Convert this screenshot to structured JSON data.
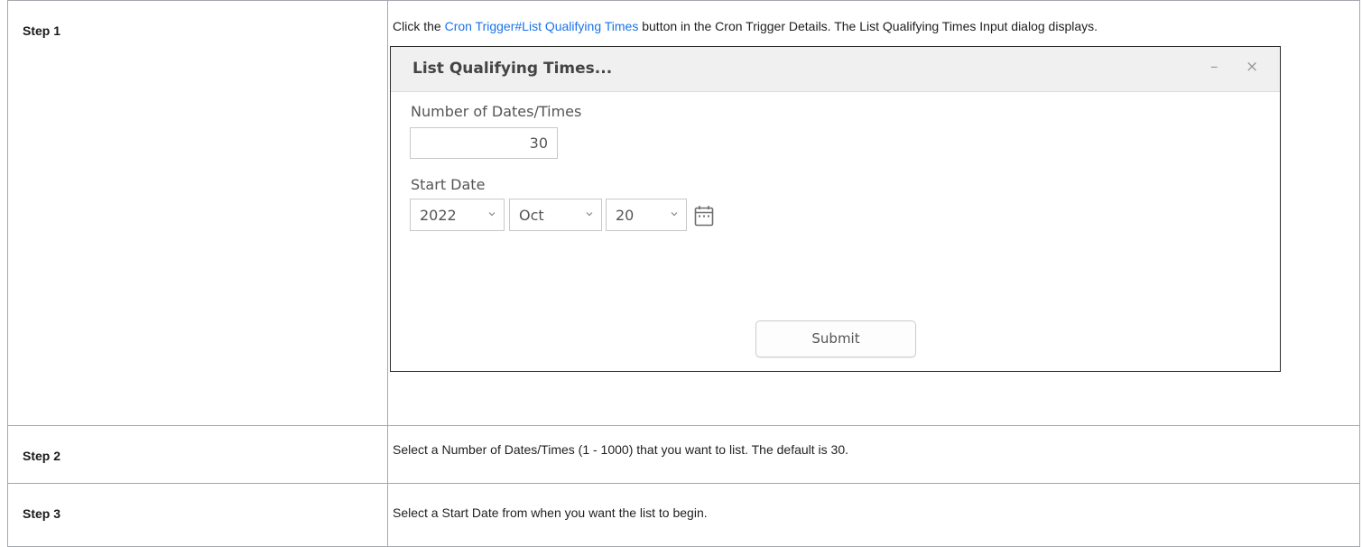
{
  "steps": [
    {
      "label": "Step 1",
      "text_before_link": "Click the ",
      "link_text": "Cron Trigger#List Qualifying Times",
      "text_after_link": " button in the Cron Trigger Details. The List Qualifying Times Input dialog displays."
    },
    {
      "label": "Step 2",
      "text": "Select a Number of Dates/Times (1 - 1000) that you want to list. The default is 30."
    },
    {
      "label": "Step 3",
      "text": "Select a Start Date from when you want the list to begin."
    }
  ],
  "dialog": {
    "title": "List Qualifying Times...",
    "minimize_glyph": "–",
    "close_glyph": "×",
    "number_label": "Number of Dates/Times",
    "number_value": "30",
    "start_date_label": "Start Date",
    "year_value": "2022",
    "month_value": "Oct",
    "day_value": "20",
    "chevron_glyph": "⌄",
    "calendar_icon": "calendar-icon",
    "submit_label": "Submit"
  },
  "colors": {
    "link": "#1a73e8",
    "table_border": "#a6a6b0",
    "dialog_header_bg": "#f0f0f0"
  }
}
